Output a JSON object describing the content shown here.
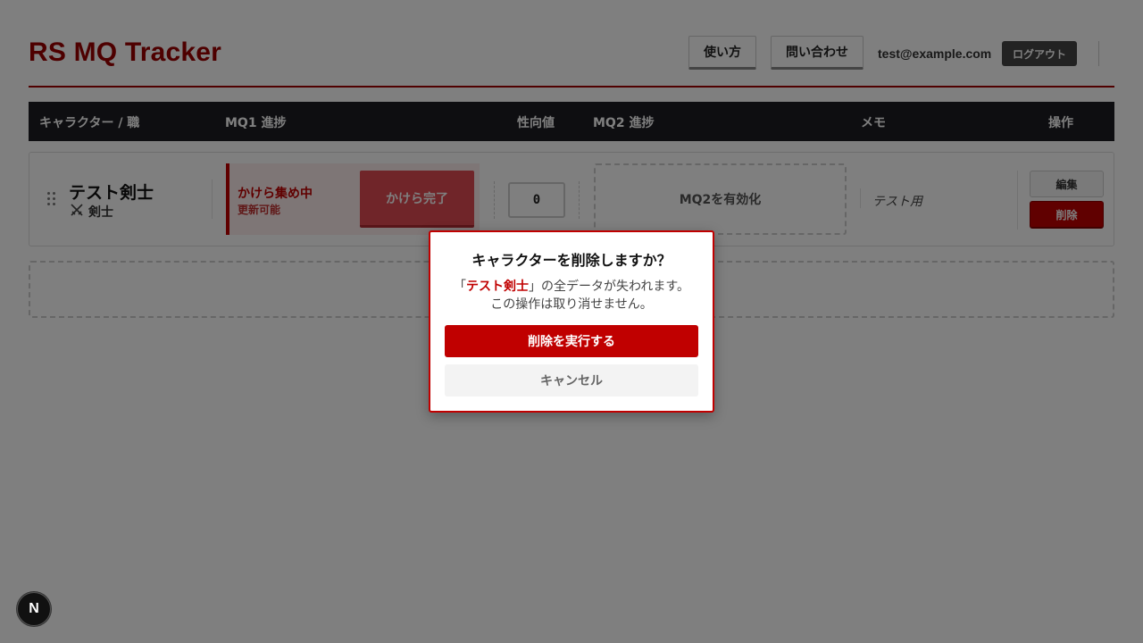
{
  "header": {
    "title": "RS MQ Tracker",
    "howto_label": "使い方",
    "contact_label": "問い合わせ",
    "user_email": "test@example.com",
    "logout_label": "ログアウト"
  },
  "table": {
    "columns": [
      "キャラクター / 職",
      "MQ1 進捗",
      "性向値",
      "MQ2 進捗",
      "メモ",
      "操作"
    ]
  },
  "character": {
    "name": "テスト剣士",
    "job": "剣士",
    "job_icon": "swords-icon",
    "mq1_status": "かけら集め中",
    "mq1_sub": "更新可能",
    "mq1_action": "かけら完了",
    "alignment": "0",
    "mq2_action": "MQ2を有効化",
    "memo": "テスト用",
    "edit_label": "編集",
    "delete_label": "削除"
  },
  "dialog": {
    "title": "キャラクターを削除しますか？",
    "msg_prefix": "「",
    "msg_name": "テスト剣士",
    "msg_suffix": "」の全データが失われます。",
    "msg_line2": "この操作は取り消せません。",
    "confirm_label": "削除を実行する",
    "cancel_label": "キャンセル"
  },
  "badge": {
    "label": "N"
  },
  "colors": {
    "accent": "#c00000",
    "header_bg": "#1c1c22"
  }
}
